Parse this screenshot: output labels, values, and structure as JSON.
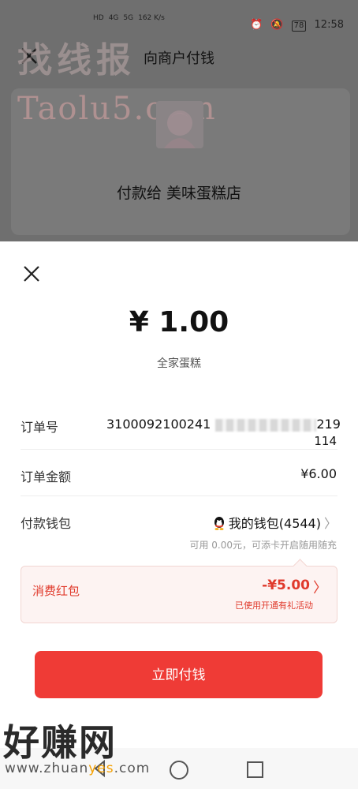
{
  "status_bar": {
    "left_items": [
      "HD",
      "4G",
      "HD",
      "5G",
      "162 K/s"
    ],
    "battery": "78",
    "time": "12:58"
  },
  "background": {
    "title": "向商户付钱",
    "pay_to": "付款给 美味蛋糕店"
  },
  "watermarks": {
    "top_brand": "找线报",
    "top_url": "Taolu5.com",
    "bottom_brand": "好赚网",
    "bottom_domain_prefix": "www.zhuan",
    "bottom_domain_highlight": "yes",
    "bottom_domain_suffix": ".com"
  },
  "payment": {
    "amount": "¥ 1.00",
    "merchant_item": "全家蛋糕",
    "rows": {
      "order_no_label": "订单号",
      "order_no_visible_start": "3100092100241",
      "order_no_visible_end_a": "219",
      "order_no_visible_end_b": "114",
      "order_amount_label": "订单金额",
      "order_amount_value": "¥6.00",
      "wallet_label": "付款钱包",
      "wallet_value": "我的钱包(4544)",
      "wallet_hint": "可用 0.00元，可添卡开启随用随充"
    },
    "red_packet": {
      "label": "消费红包",
      "amount": "-¥5.00",
      "note": "已使用开通有礼活动"
    },
    "pay_button": "立即付钱"
  },
  "colors": {
    "accent_red": "#ef3b36",
    "red_text": "#e03a2c",
    "redpacket_bg": "#fdf3f2"
  },
  "icons": [
    "close-icon",
    "chevron-right-icon",
    "qq-penguin-icon",
    "back-icon",
    "home-icon",
    "recent-apps-icon"
  ]
}
